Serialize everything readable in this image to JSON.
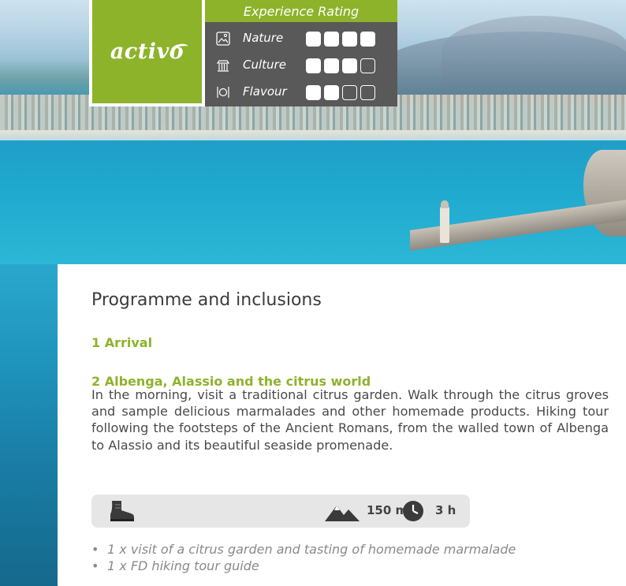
{
  "brand": {
    "logo_text": "activo"
  },
  "rating": {
    "title": "Experience Rating",
    "rows": [
      {
        "label": "Nature",
        "filled": 4,
        "total": 4,
        "icon": "nature-icon"
      },
      {
        "label": "Culture",
        "filled": 3,
        "total": 4,
        "icon": "culture-icon"
      },
      {
        "label": "Flavour",
        "filled": 2,
        "total": 4,
        "icon": "flavour-icon"
      }
    ]
  },
  "content": {
    "heading": "Programme and inclusions",
    "day1": "1 Arrival",
    "day2": "2 Albenga, Alassio and the citrus world",
    "day2_text": "In the morning, visit a traditional citrus garden. Walk through the citrus groves and sample delicious marmalades and other homemade products. Hiking tour following the footsteps of the Ancient Romans, from the walled town of Albenga to Alassio and its beautiful seaside promenade.",
    "stats": {
      "altitude": "150 m",
      "duration": "3 h"
    },
    "inclusions": [
      "1 x visit of a citrus garden and tasting of homemade marmalade",
      "1 x FD hiking tour guide"
    ]
  },
  "colors": {
    "accent": "#8db32b",
    "panel": "#595959"
  }
}
